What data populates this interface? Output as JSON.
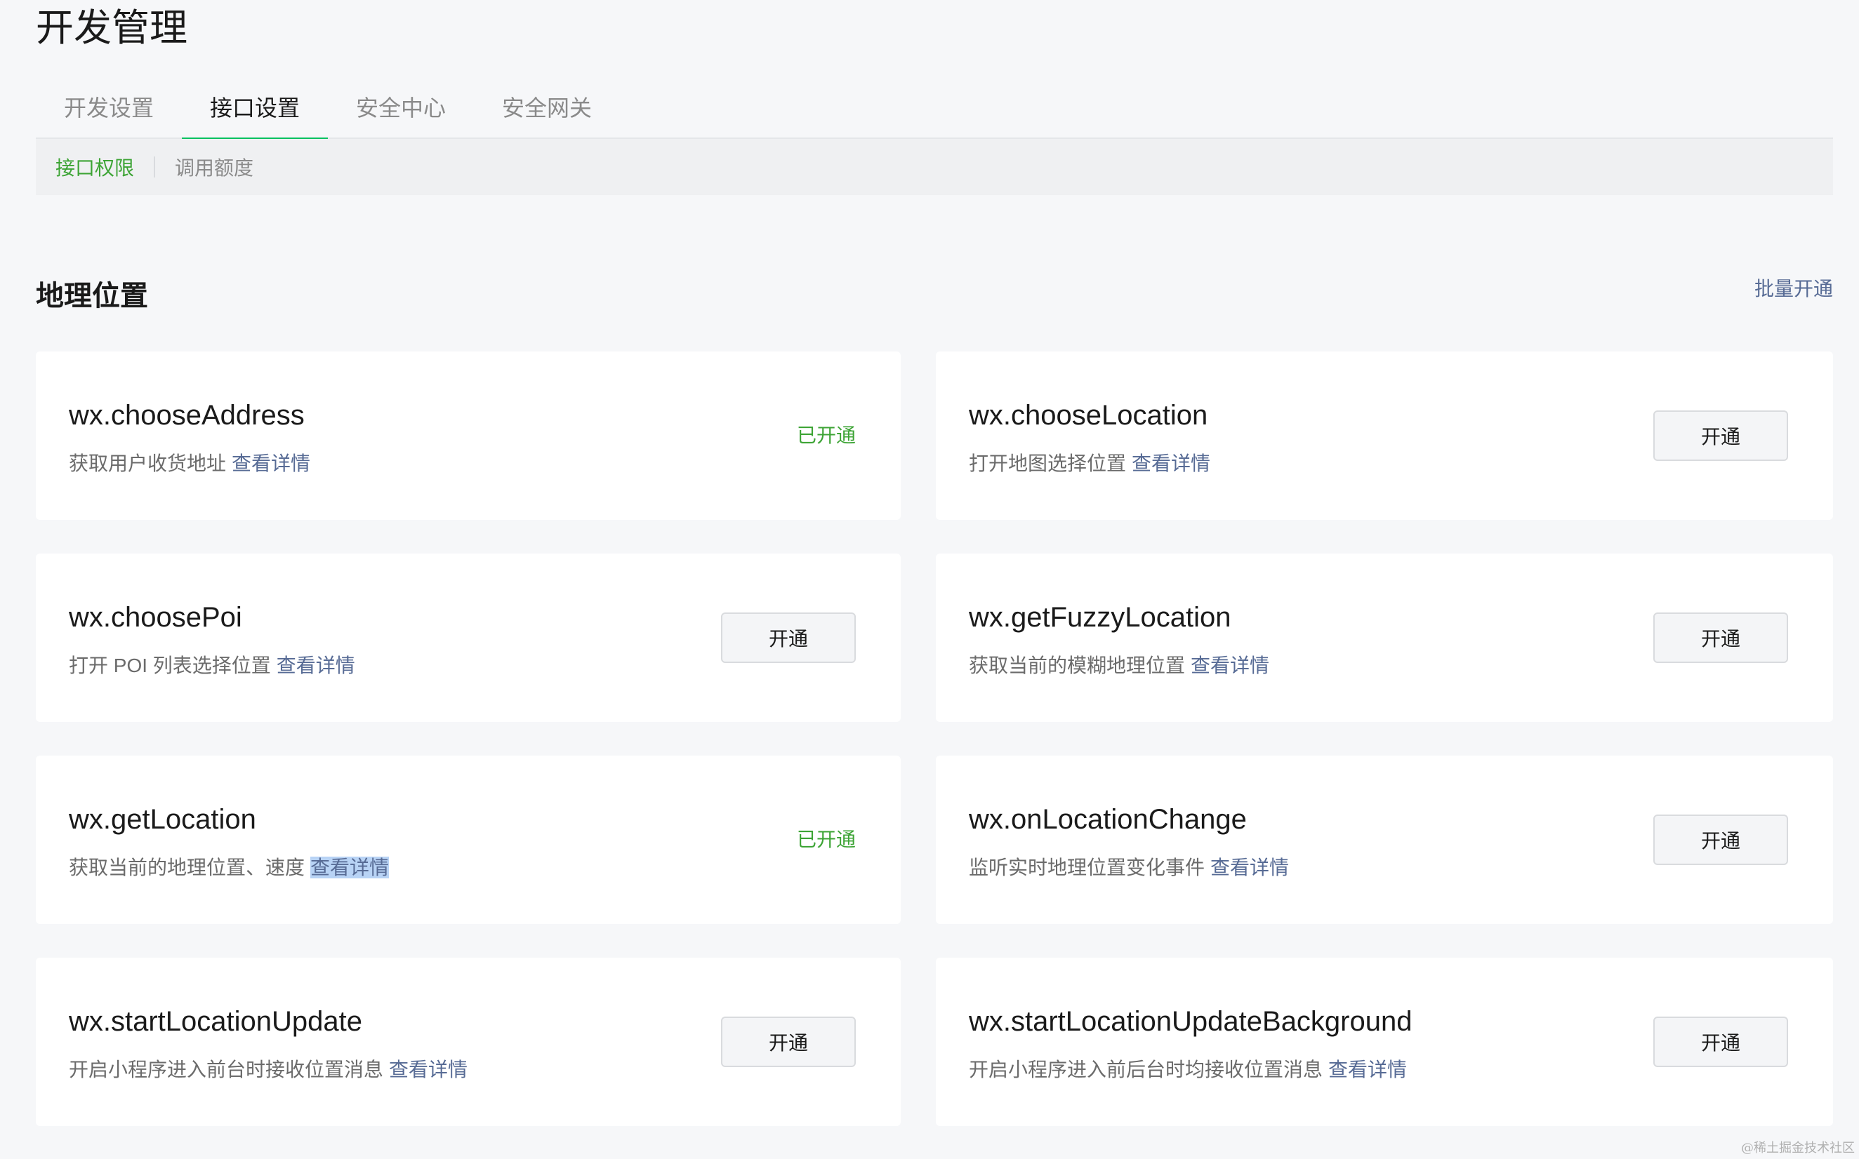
{
  "page": {
    "title": "开发管理"
  },
  "tabs": [
    {
      "label": "开发设置",
      "active": false
    },
    {
      "label": "接口设置",
      "active": true
    },
    {
      "label": "安全中心",
      "active": false
    },
    {
      "label": "安全网关",
      "active": false
    }
  ],
  "subtabs": [
    {
      "label": "接口权限",
      "active": true
    },
    {
      "label": "调用额度",
      "active": false
    }
  ],
  "section": {
    "title": "地理位置",
    "batch_label": "批量开通"
  },
  "detail_label": "查看详情",
  "opened_label": "已开通",
  "open_button_label": "开通",
  "apis": [
    {
      "name": "wx.chooseAddress",
      "desc": "获取用户收货地址",
      "status": "opened"
    },
    {
      "name": "wx.chooseLocation",
      "desc": "打开地图选择位置",
      "status": "closed"
    },
    {
      "name": "wx.choosePoi",
      "desc": "打开 POI 列表选择位置",
      "status": "closed"
    },
    {
      "name": "wx.getFuzzyLocation",
      "desc": "获取当前的模糊地理位置",
      "status": "closed"
    },
    {
      "name": "wx.getLocation",
      "desc": "获取当前的地理位置、速度",
      "status": "opened"
    },
    {
      "name": "wx.onLocationChange",
      "desc": "监听实时地理位置变化事件",
      "status": "closed"
    },
    {
      "name": "wx.startLocationUpdate",
      "desc": "开启小程序进入前台时接收位置消息",
      "status": "closed"
    },
    {
      "name": "wx.startLocationUpdateBackground",
      "desc": "开启小程序进入前后台时均接收位置消息",
      "status": "closed"
    }
  ],
  "watermark": "@稀土掘金技术社区",
  "colors": {
    "accent_green": "#07c160",
    "link_blue": "#576b95",
    "status_green": "#3da435"
  }
}
